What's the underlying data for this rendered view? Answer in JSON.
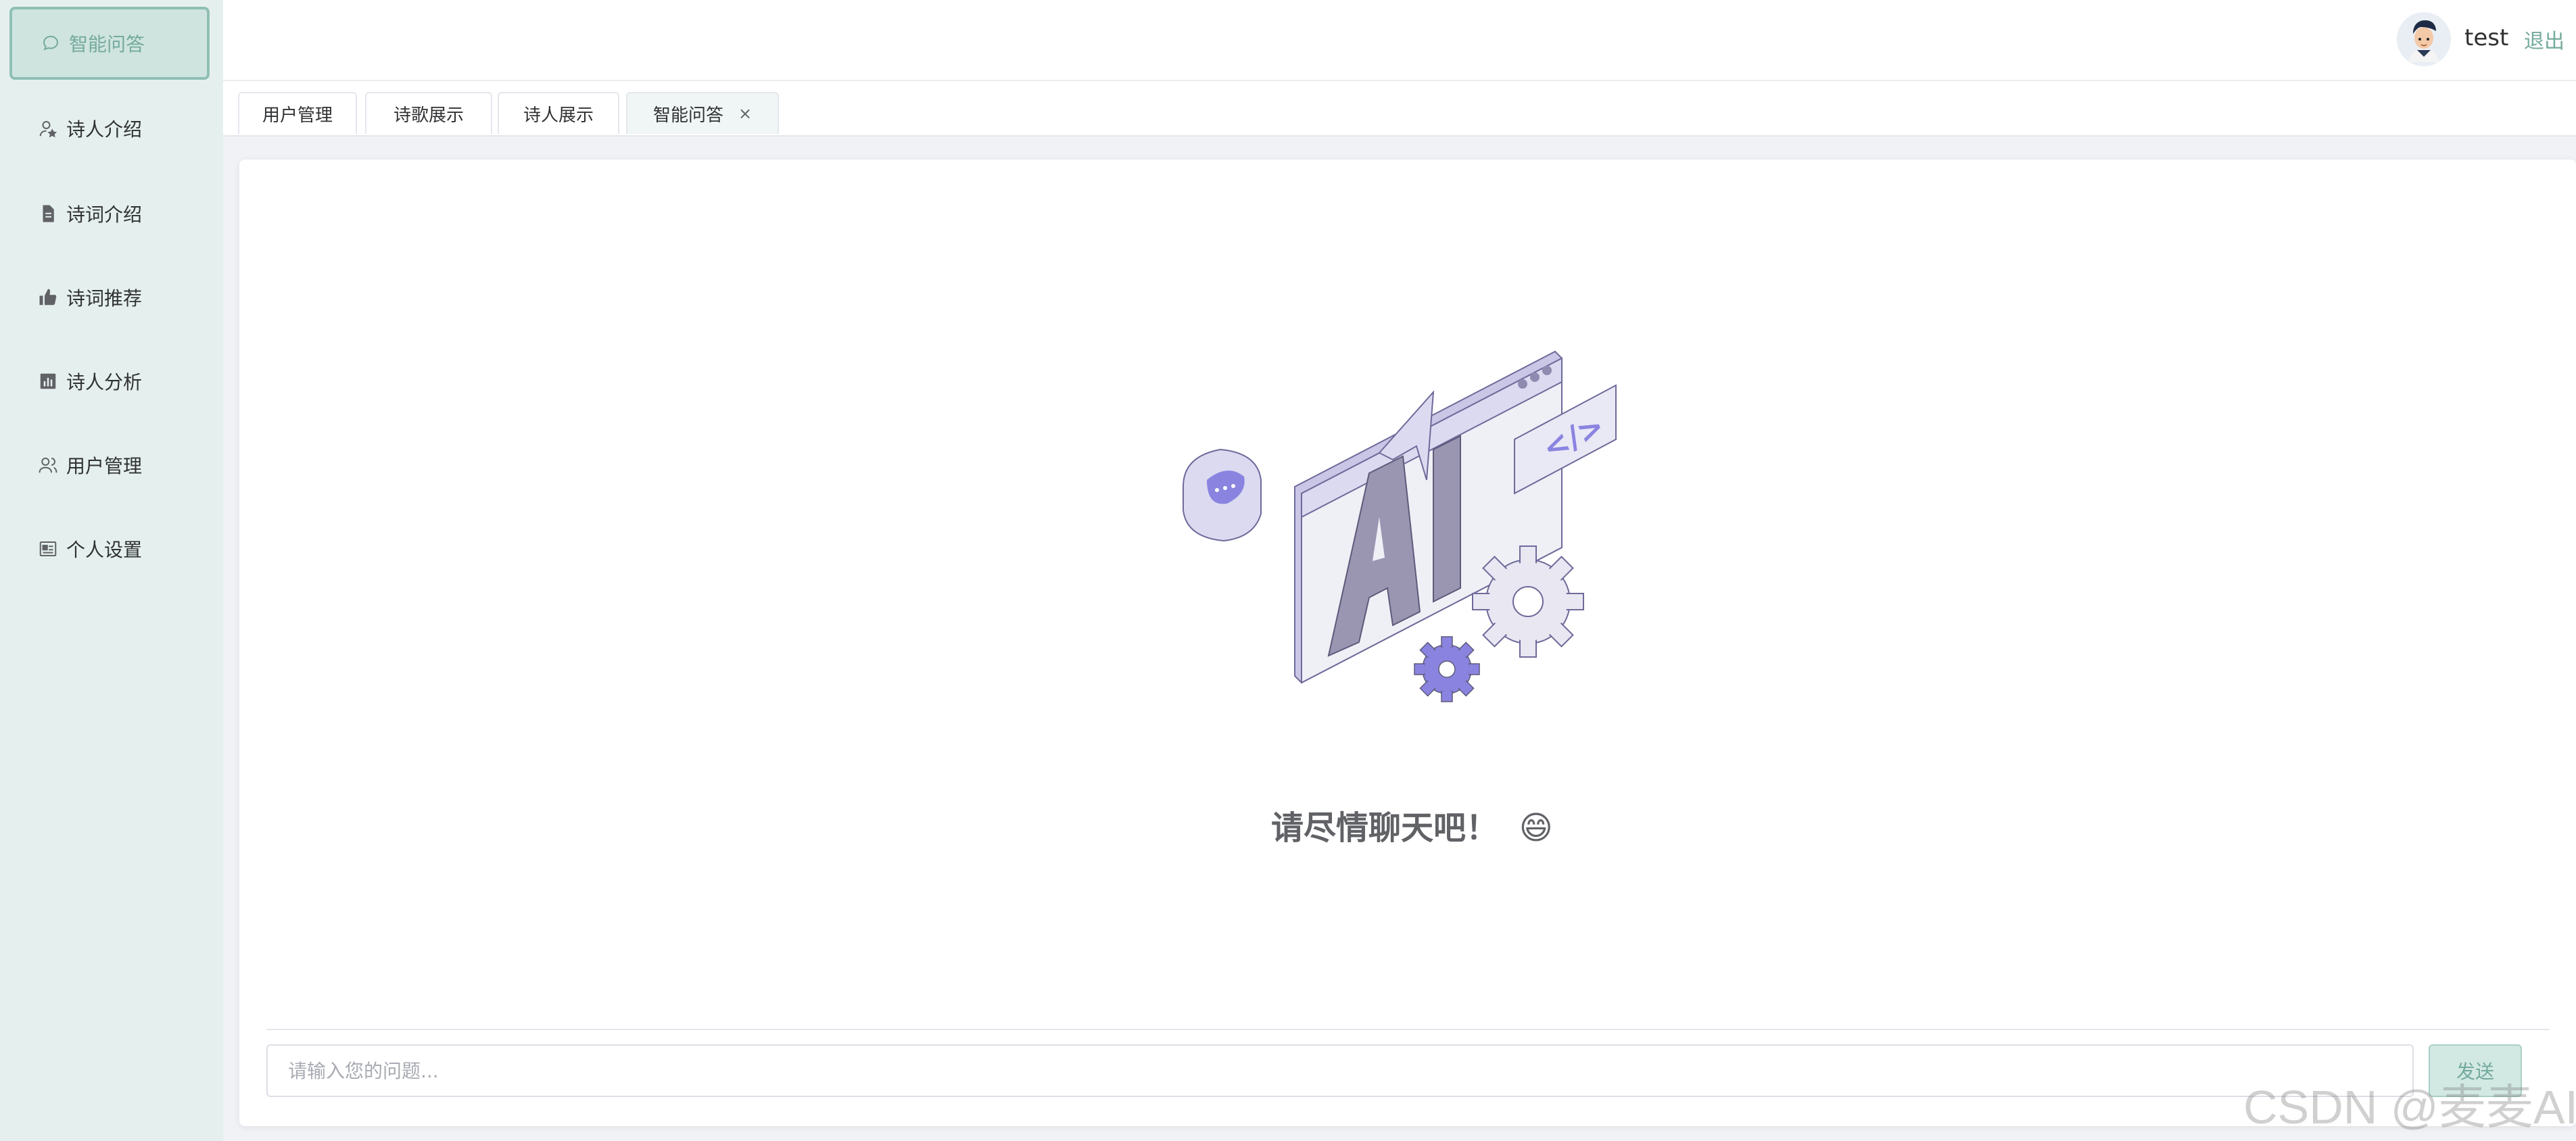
{
  "sidebar": {
    "items": [
      {
        "label": "智能问答",
        "icon": "chat-bubble-icon",
        "active": true
      },
      {
        "label": "诗人介绍",
        "icon": "user-star-icon",
        "active": false
      },
      {
        "label": "诗词介绍",
        "icon": "document-icon",
        "active": false
      },
      {
        "label": "诗词推荐",
        "icon": "thumbs-up-icon",
        "active": false
      },
      {
        "label": "诗人分析",
        "icon": "bar-chart-icon",
        "active": false
      },
      {
        "label": "用户管理",
        "icon": "users-icon",
        "active": false
      },
      {
        "label": "个人设置",
        "icon": "profile-card-icon",
        "active": false
      }
    ]
  },
  "header": {
    "username": "test",
    "logout_label": "退出"
  },
  "tabs": [
    {
      "label": "用户管理",
      "active": false
    },
    {
      "label": "诗歌展示",
      "active": false
    },
    {
      "label": "诗人展示",
      "active": false
    },
    {
      "label": "智能问答",
      "active": true,
      "close": "×"
    }
  ],
  "main": {
    "illustration_text": "AI",
    "code_tag_text": "</>",
    "welcome_text": "请尽情聊天吧！",
    "welcome_emoji": "😄",
    "input_placeholder": "请输入您的问题...",
    "send_label": "发送"
  },
  "watermark": "CSDN @麦麦AI",
  "colors": {
    "accent": "#74aa9c",
    "sidebar_bg": "#e5f0ee",
    "illustration_purple": "#8a84e0"
  }
}
